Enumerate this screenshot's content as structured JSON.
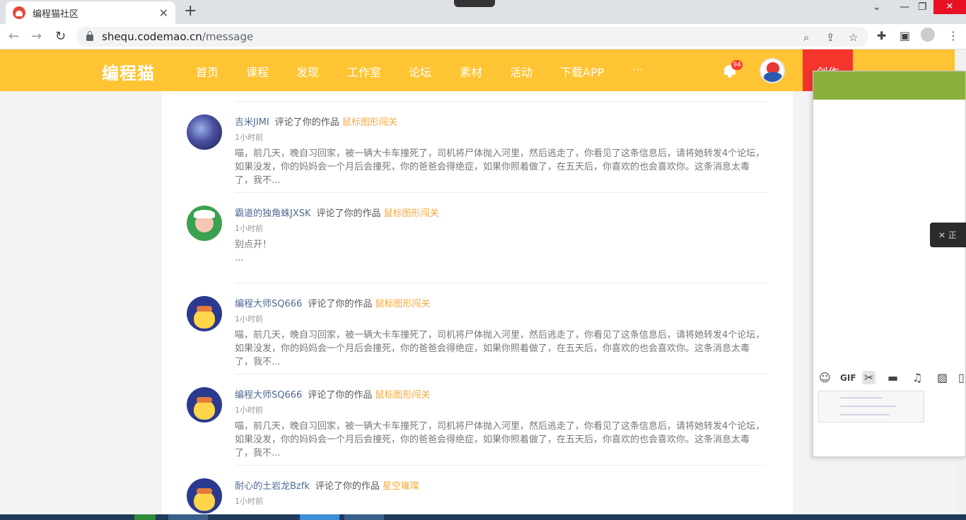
{
  "browser": {
    "tab_title": "编程猫社区",
    "close_glyph": "✕",
    "newtab_glyph": "+",
    "url_host": "shequ.codemao.cn",
    "url_path": "/message"
  },
  "site": {
    "logo": "编程猫",
    "nav": [
      "首页",
      "课程",
      "发现",
      "工作室",
      "论坛",
      "素材",
      "活动",
      "下载APP",
      "···"
    ],
    "notification_count": "94",
    "create_label": "创作",
    "colors": {
      "header": "#fec433",
      "create": "#f5352b",
      "link": "#4f6a92",
      "work": "#f7a738"
    }
  },
  "messages": [
    {
      "user": "吉米JIMI",
      "verb": "评论了你的作品",
      "work": "鼠标图形闯关",
      "time": "1小时前",
      "text": "喵，前几天，晚自习回家，被一辆大卡车撞死了，司机将尸体抛入河里，然后逃走了，你看见了这条信息后，请将她转发4个论坛，如果没发，你的妈妈会一个月后会撞死，你的爸爸会得绝症，如果你照着做了，在五天后，你喜欢的也会喜欢你。这条消息太毒了，我不..."
    },
    {
      "user": "霸道的独角蛛JXSK",
      "verb": "评论了你的作品",
      "work": "鼠标图形闯关",
      "time": "1小时前",
      "text": "别点开！\n..."
    },
    {
      "user": "编程大师SQ666",
      "verb": "评论了你的作品",
      "work": "鼠标图形闯关",
      "time": "1小时前",
      "text": "喵，前几天，晚自习回家，被一辆大卡车撞死了，司机将尸体抛入河里，然后逃走了，你看见了这条信息后，请将她转发4个论坛，如果没发，你的妈妈会一个月后会撞死，你的爸爸会得绝症，如果你照着做了，在五天后，你喜欢的也会喜欢你。这条消息太毒了，我不..."
    },
    {
      "user": "编程大师SQ666",
      "verb": "评论了你的作品",
      "work": "鼠标图形闯关",
      "time": "1小时前",
      "text": "喵，前几天，晚自习回家，被一辆大卡车撞死了，司机将尸体抛入河里，然后逃走了，你看见了这条信息后，请将她转发4个论坛，如果没发，你的妈妈会一个月后会撞死，你的爸爸会得绝症，如果你照着做了，在五天后，你喜欢的也会喜欢你。这条消息太毒了，我不..."
    },
    {
      "user": "耐心的土岩龙Bzfk",
      "verb": "评论了你的作品",
      "work": "星空璀璨",
      "time": "1小时前",
      "text": ""
    }
  ],
  "chat_panel": {
    "mic_tip": "正",
    "toolbar_icons": [
      "emoji-icon",
      "gif-icon",
      "scissors-icon",
      "folder-icon",
      "headset-icon",
      "image-icon",
      "more-icon"
    ],
    "gif_label": "GIF"
  }
}
